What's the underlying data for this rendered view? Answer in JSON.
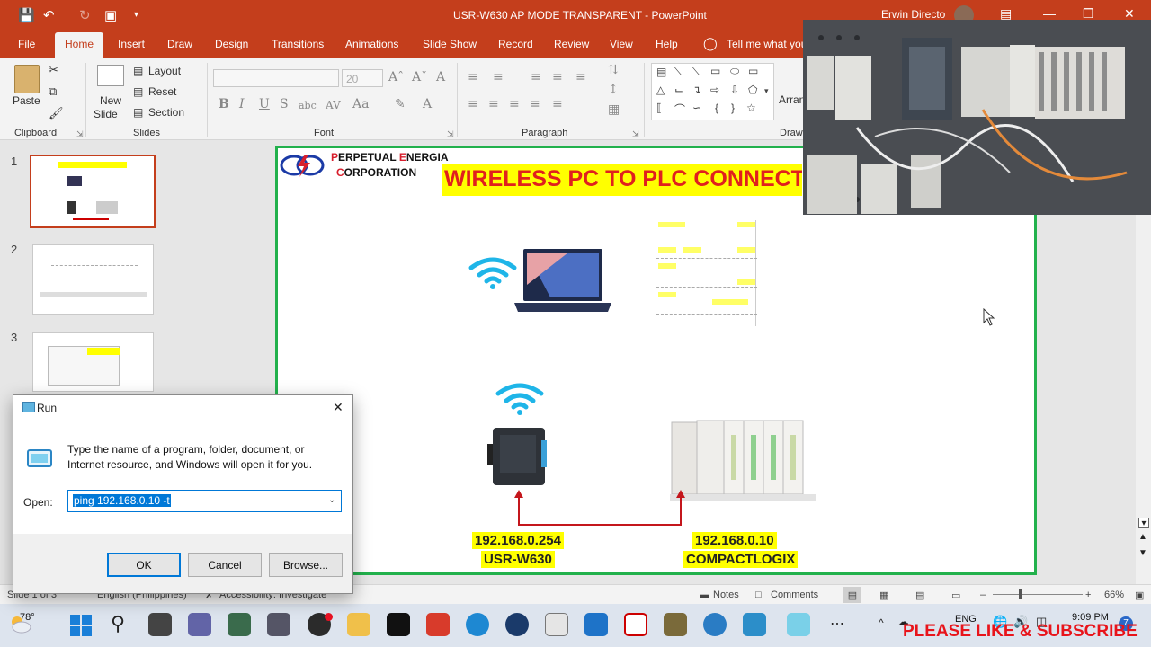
{
  "window": {
    "title": "USR-W630 AP MODE TRANSPARENT  -  PowerPoint",
    "user": "Erwin Directo"
  },
  "menu": {
    "tabs": [
      "File",
      "Home",
      "Insert",
      "Draw",
      "Design",
      "Transitions",
      "Animations",
      "Slide Show",
      "Record",
      "Review",
      "View",
      "Help"
    ],
    "active": "Home",
    "tell_me": "Tell me what you"
  },
  "ribbon": {
    "paste": "Paste",
    "new_slide_1": "New",
    "new_slide_2": "Slide",
    "layout": "Layout",
    "reset": "Reset",
    "section": "Section",
    "font_size": "20",
    "arrange": "Arran",
    "draw_label": "Draw",
    "groups": {
      "clipboard": "Clipboard",
      "slides": "Slides",
      "font": "Font",
      "paragraph": "Paragraph"
    }
  },
  "thumbnails": [
    "1",
    "2",
    "3"
  ],
  "slide": {
    "logo_line1_p": "P",
    "logo_line1_rest": "ERPETUAL ",
    "logo_line1_e": "E",
    "logo_line1_end": "NERGIA",
    "logo_line2_c": "C",
    "logo_line2_rest": "ORPORATION",
    "title": "WIRELESS PC TO PLC CONNECTION",
    "ip_left": "192.168.0.254",
    "name_left": "USR-W630",
    "ip_right": "192.168.0.10",
    "name_right": "COMPACTLOGIX"
  },
  "run_dialog": {
    "title": "Run",
    "description": "Type the name of a program, folder, document, or Internet resource, and Windows will open it for you.",
    "open_label": "Open:",
    "command": "ping 192.168.0.10 -t",
    "ok": "OK",
    "cancel": "Cancel",
    "browse": "Browse..."
  },
  "statusbar": {
    "slide_info": "Slide 1 of 3",
    "language": "English (Philippines)",
    "accessibility": "Accessibility: Investigate",
    "notes": "Notes",
    "comments": "Comments",
    "zoom": "66%"
  },
  "taskbar": {
    "weather": "78°",
    "lang": "ENG",
    "time": "9:09 PM",
    "notif": "7"
  },
  "overlay": {
    "subscribe": "PLEASE LIKE & SUBSCRIBE"
  },
  "colors": {
    "accent": "#c43e1c",
    "slide_border": "#22b14c",
    "title_bg": "#ffff00",
    "title_text": "#e0201e"
  }
}
